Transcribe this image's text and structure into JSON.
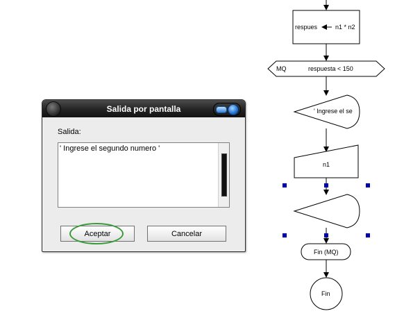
{
  "flowchart": {
    "assign": {
      "variable": "respues",
      "expression": "n1 * n2"
    },
    "loop": {
      "keyword": "MQ",
      "condition": "respuesta < 150"
    },
    "output1": {
      "text": "' Ingrese el se"
    },
    "input": {
      "text": "n1"
    },
    "output2": {
      "text": ""
    },
    "loop_end": {
      "text": "Fin (MQ)"
    },
    "end": {
      "text": "Fin"
    }
  },
  "dialog": {
    "title": "Salida por pantalla",
    "output_label": "Salida:",
    "output_text": "' Ingrese el segundo numero '",
    "accept_label": "Aceptar",
    "cancel_label": "Cancelar"
  },
  "colors": {
    "handle": "#0000aa",
    "highlight": "#3a9a3a",
    "close_button": "#1d6fd0"
  }
}
